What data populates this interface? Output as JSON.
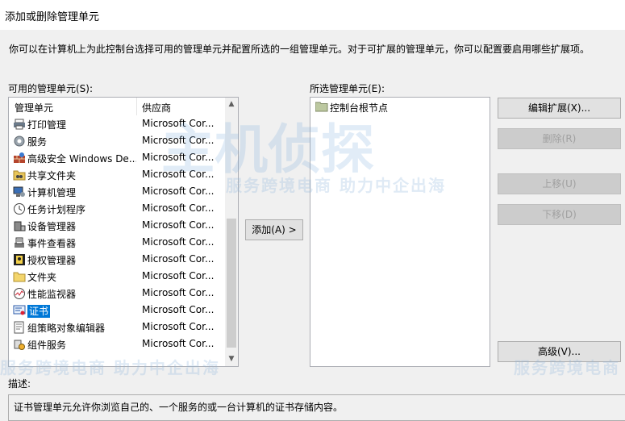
{
  "window": {
    "title": "添加或删除管理单元"
  },
  "intro": "你可以在计算机上为此控制台选择可用的管理单元并配置所选的一组管理单元。对于可扩展的管理单元，你可以配置要启用哪些扩展项。",
  "available": {
    "label": "可用的管理单元(S):",
    "col_name": "管理单元",
    "col_vendor": "供应商",
    "items": [
      {
        "name": "打印管理",
        "vendor": "Microsoft Cor...",
        "icon": "printer-icon"
      },
      {
        "name": "服务",
        "vendor": "Microsoft Cor...",
        "icon": "gear-icon"
      },
      {
        "name": "高级安全 Windows De...",
        "vendor": "Microsoft Cor...",
        "icon": "firewall-icon"
      },
      {
        "name": "共享文件夹",
        "vendor": "Microsoft Cor...",
        "icon": "shared-folder-icon"
      },
      {
        "name": "计算机管理",
        "vendor": "Microsoft Cor...",
        "icon": "computer-management-icon"
      },
      {
        "name": "任务计划程序",
        "vendor": "Microsoft Cor...",
        "icon": "clock-icon"
      },
      {
        "name": "设备管理器",
        "vendor": "Microsoft Cor...",
        "icon": "device-manager-icon"
      },
      {
        "name": "事件查看器",
        "vendor": "Microsoft Cor...",
        "icon": "event-viewer-icon"
      },
      {
        "name": "授权管理器",
        "vendor": "Microsoft Cor...",
        "icon": "authorization-icon"
      },
      {
        "name": "文件夹",
        "vendor": "Microsoft Cor...",
        "icon": "folder-icon"
      },
      {
        "name": "性能监视器",
        "vendor": "Microsoft Cor...",
        "icon": "performance-monitor-icon"
      },
      {
        "name": "证书",
        "vendor": "Microsoft Cor...",
        "icon": "certificate-icon"
      },
      {
        "name": "组策略对象编辑器",
        "vendor": "Microsoft Cor...",
        "icon": "group-policy-icon"
      },
      {
        "name": "组件服务",
        "vendor": "Microsoft Cor...",
        "icon": "component-services-icon"
      }
    ]
  },
  "add_button": "添加(A) >",
  "selected": {
    "label": "所选管理单元(E):",
    "root": "控制台根节点"
  },
  "buttons": {
    "edit_ext": "编辑扩展(X)...",
    "remove": "删除(R)",
    "move_up": "上移(U)",
    "move_down": "下移(D)",
    "advanced": "高级(V)..."
  },
  "description": {
    "label": "描述:",
    "text": "证书管理单元允许你浏览自己的、一个服务的或一台计算机的证书存储内容。"
  },
  "watermark": {
    "brand": "主机侦探",
    "slogan": "服务跨境电商 助力中企出海",
    "slogan_right": "服务跨境电商"
  },
  "colors": {
    "selection": "#0078d7",
    "client_bg": "#f0f0f0"
  }
}
